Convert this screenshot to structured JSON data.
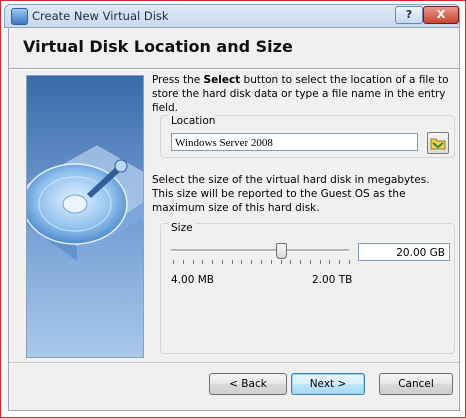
{
  "window": {
    "title": "Create New Virtual Disk",
    "help_label": "?",
    "close_label": "X"
  },
  "page": {
    "heading": "Virtual Disk Location and Size"
  },
  "location": {
    "intro_prefix": "Press the ",
    "intro_bold": "Select",
    "intro_suffix": " button to select the location of a file to store the hard disk data or type a file name in the entry field.",
    "group_label": "Location",
    "value": "Windows Server 2008"
  },
  "size": {
    "description": "Select the size of the virtual hard disk in megabytes. This size will be reported to the Guest OS as the maximum size of this hard disk.",
    "group_label": "Size",
    "value": "20.00 GB",
    "min_label": "4.00 MB",
    "max_label": "2.00 TB",
    "slider_fraction": 0.62
  },
  "buttons": {
    "back": "< Back",
    "next": "Next >",
    "cancel": "Cancel"
  },
  "colors": {
    "accent": "#3c7fb1",
    "window_border": "#cf2b2b",
    "panel_blue": "#3a6aa9"
  }
}
